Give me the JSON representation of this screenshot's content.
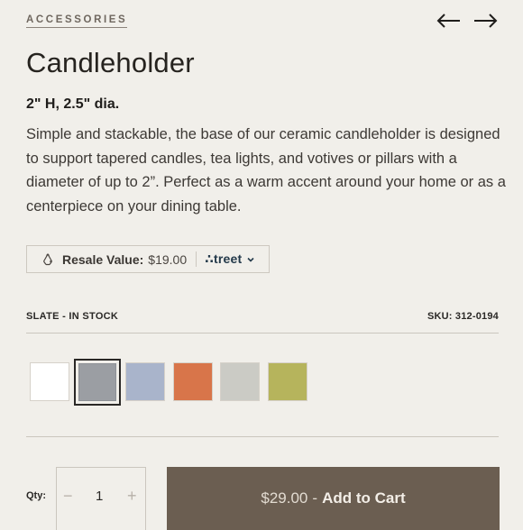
{
  "product": {
    "category": "ACCESSORIES",
    "title": "Candleholder",
    "dimensions": "2\" H, 2.5\" dia.",
    "description": "Simple and stackable, the base of our ceramic candleholder is designed to support tapered candles, tea lights, and votives or pillars with a diameter of up to 2”. Perfect as a warm accent around your home or as a centerpiece on your dining table."
  },
  "navigation": {
    "prev_icon": "arrow-left-icon",
    "next_icon": "arrow-right-icon"
  },
  "resale": {
    "icon": "recycle-icon",
    "label": "Resale Value:",
    "price": "$19.00",
    "brand": "∴treet",
    "dropdown_icon": "chevron-down-icon"
  },
  "inventory": {
    "status": "SLATE - IN STOCK",
    "sku": "SKU: 312-0194"
  },
  "swatches": [
    {
      "name": "white",
      "color": "#ffffff",
      "selected": false
    },
    {
      "name": "slate",
      "color": "#9b9ea3",
      "selected": true
    },
    {
      "name": "blue",
      "color": "#a9b4cb",
      "selected": false
    },
    {
      "name": "orange",
      "color": "#d8754a",
      "selected": false
    },
    {
      "name": "grey",
      "color": "#cbcbc5",
      "selected": false
    },
    {
      "name": "olive",
      "color": "#b6b45c",
      "selected": false
    }
  ],
  "purchase": {
    "qty_label": "Qty:",
    "quantity": "1",
    "minus": "−",
    "plus": "+",
    "price": "$29.00",
    "separator": "-",
    "cta": "Add to Cart"
  },
  "colors": {
    "background": "#f1efea",
    "cart_button": "#6b5e51"
  }
}
